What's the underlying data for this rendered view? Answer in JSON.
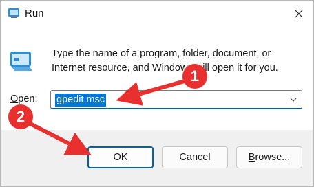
{
  "window": {
    "title": "Run",
    "close_icon": "close-icon"
  },
  "dialog": {
    "description": "Type the name of a program, folder, document, or Internet resource, and Windows will open it for you.",
    "open_label": "Open:",
    "open_input_value": "gpedit.msc"
  },
  "buttons": {
    "ok": "OK",
    "cancel": "Cancel",
    "browse": "Browse..."
  },
  "annotations": [
    {
      "number": "1",
      "color": "#e8312f"
    },
    {
      "number": "2",
      "color": "#e8312f"
    }
  ],
  "colors": {
    "selection": "#0078d7",
    "accent_border": "#005fb8",
    "annotation": "#e8312f"
  }
}
